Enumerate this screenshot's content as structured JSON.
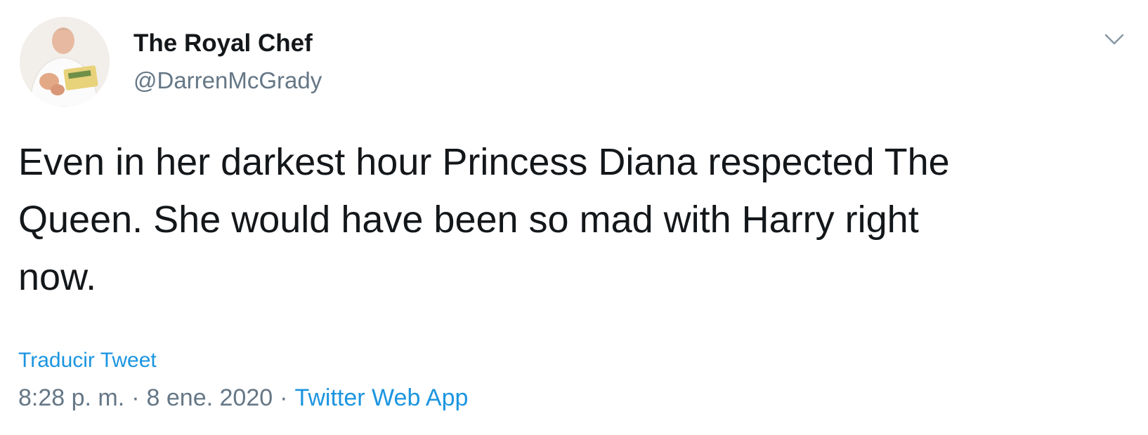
{
  "author": {
    "display_name": "The Royal Chef",
    "handle": "@DarrenMcGrady",
    "avatar_icon": "chef-avatar"
  },
  "tweet": {
    "text": "Even in her darkest hour Princess Diana respected The\nQueen. She would have been so mad with Harry right\nnow.",
    "translate_label": "Traducir Tweet",
    "time": "8:28 p. m.",
    "separator": "·",
    "date": "8 ene. 2020",
    "source": "Twitter Web App"
  },
  "menu": {
    "icon": "chevron-down-icon"
  },
  "colors": {
    "link": "#1b95e0",
    "muted": "#657786",
    "text": "#14171a"
  }
}
